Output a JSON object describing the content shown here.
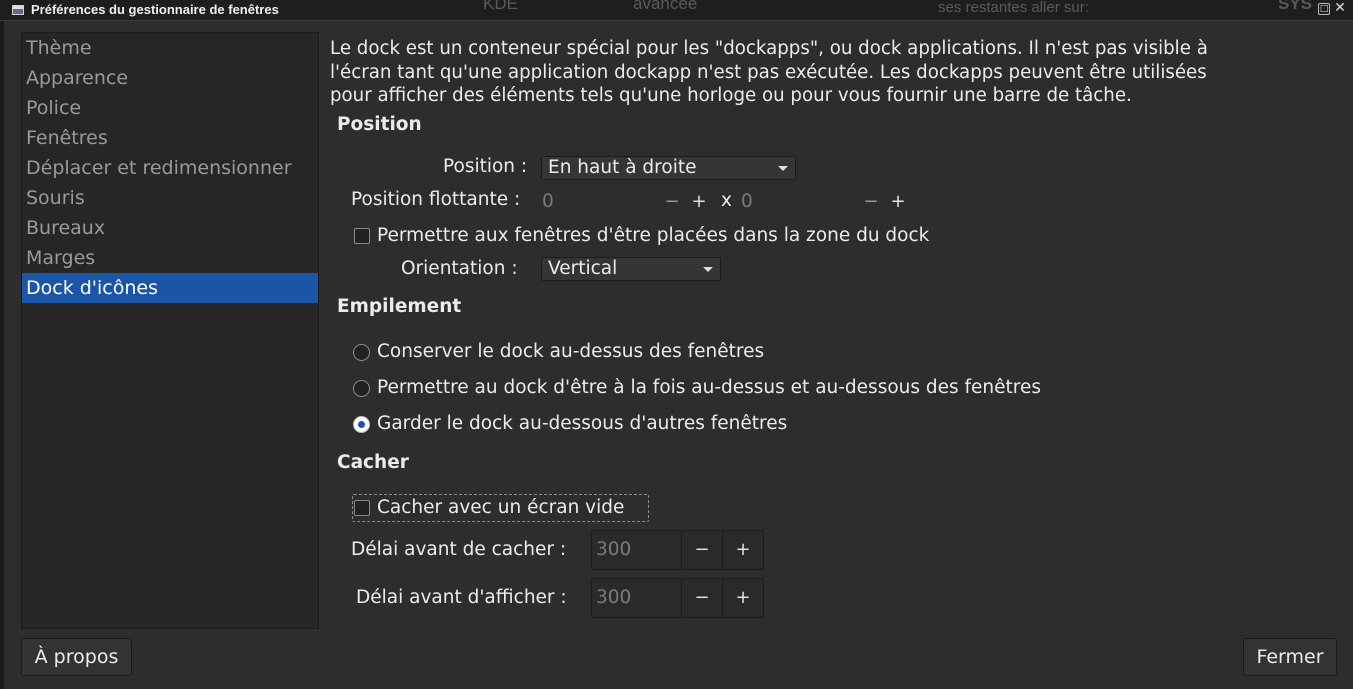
{
  "window": {
    "title": "Préférences du gestionnaire de fenêtres",
    "bg_fragments": [
      "KDE",
      "avancée",
      "ses restantes aller sur:",
      "SYS"
    ]
  },
  "sidebar": {
    "items": [
      {
        "label": "Thème",
        "active": false
      },
      {
        "label": "Apparence",
        "active": false
      },
      {
        "label": "Police",
        "active": false
      },
      {
        "label": "Fenêtres",
        "active": false
      },
      {
        "label": "Déplacer et redimensionner",
        "active": false
      },
      {
        "label": "Souris",
        "active": false
      },
      {
        "label": "Bureaux",
        "active": false
      },
      {
        "label": "Marges",
        "active": false
      },
      {
        "label": "Dock d'icônes",
        "active": true
      }
    ]
  },
  "main": {
    "description": "Le dock est un conteneur spécial pour les \"dockapps\", ou dock applications.  Il n'est pas visible à\nl'écran tant qu'une application dockapp n'est pas exécutée.  Les dockapps peuvent être utilisées\npour afficher des éléments tels qu'une horloge ou pour vous fournir une barre de tâche.",
    "position_section": {
      "heading": "Position",
      "position_label": "Position :",
      "position_value": "En haut à droite",
      "floating_label": "Position flottante :",
      "floating_x": "0",
      "floating_sep": "x",
      "floating_y": "0",
      "allow_windows_label": "Permettre aux fenêtres d'être placées dans la zone du dock",
      "allow_windows_checked": false,
      "orientation_label": "Orientation :",
      "orientation_value": "Vertical"
    },
    "stacking_section": {
      "heading": "Empilement",
      "options": [
        {
          "label": "Conserver le dock au-dessus des fenêtres",
          "checked": false
        },
        {
          "label": "Permettre au dock d'être à la fois au-dessus et au-dessous des fenêtres",
          "checked": false
        },
        {
          "label": "Garder le dock au-dessous d'autres fenêtres",
          "checked": true
        }
      ]
    },
    "hide_section": {
      "heading": "Cacher",
      "autohide_label": "Cacher avec un écran vide",
      "autohide_checked": false,
      "hide_delay_label": "Délai avant de cacher :",
      "hide_delay_value": "300",
      "show_delay_label": "Délai avant d'afficher :",
      "show_delay_value": "300"
    },
    "spin_minus": "−",
    "spin_plus": "+"
  },
  "footer": {
    "about_label": "À propos",
    "close_label": "Fermer"
  },
  "colors": {
    "accent": "#1a55a8",
    "background": "#2d2d2d"
  }
}
